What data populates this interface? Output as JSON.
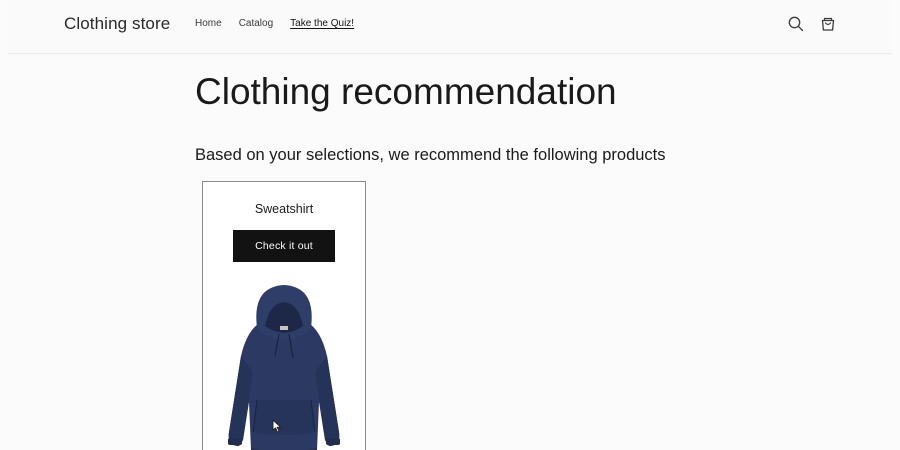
{
  "header": {
    "logo": "Clothing store",
    "nav": [
      {
        "label": "Home"
      },
      {
        "label": "Catalog"
      },
      {
        "label": "Take the Quiz!"
      }
    ],
    "icons": {
      "search": "search-icon",
      "cart": "cart-icon"
    }
  },
  "main": {
    "title": "Clothing recommendation",
    "subtitle": "Based on your selections, we recommend the following products"
  },
  "products": [
    {
      "name": "Sweatshirt",
      "cta_label": "Check it out",
      "image": "navy-hooded-sweatshirt"
    }
  ],
  "colors": {
    "button_bg": "#121212",
    "button_text": "#ffffff",
    "product_navy": "#2c3a63",
    "page_bg": "#fbfbfb"
  }
}
